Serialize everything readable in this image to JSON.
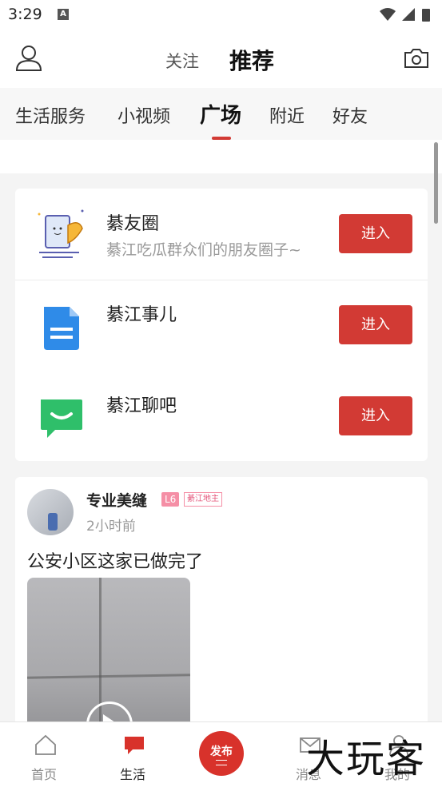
{
  "status": {
    "time": "3:29",
    "notif_glyph": "A"
  },
  "header": {
    "follow_label": "关注",
    "recommend_label": "推荐"
  },
  "tabs": [
    {
      "label": "生活服务"
    },
    {
      "label": "小视频"
    },
    {
      "label": "广场",
      "active": true
    },
    {
      "label": "附近"
    },
    {
      "label": "好友"
    }
  ],
  "portals": [
    {
      "title": "綦友圈",
      "subtitle": "綦江吃瓜群众们的朋友圈子~",
      "button": "进入",
      "icon": "notebook-feather-icon"
    },
    {
      "title": "綦江事儿",
      "subtitle": "",
      "button": "进入",
      "icon": "blue-document-icon"
    },
    {
      "title": "綦江聊吧",
      "subtitle": "",
      "button": "进入",
      "icon": "green-chat-icon"
    }
  ],
  "post": {
    "user": "专业美缝",
    "level_badge": "L6",
    "title_badge": "綦江地主",
    "time": "2小时前",
    "text": "公安小区这家已做完了"
  },
  "bottom_nav": {
    "home": "首页",
    "life": "生活",
    "publish": "发布",
    "messages": "消息",
    "mine": "我的"
  },
  "watermark": "大玩客",
  "colors": {
    "accent": "#d23a34",
    "badge_pink": "#f58fa6"
  }
}
